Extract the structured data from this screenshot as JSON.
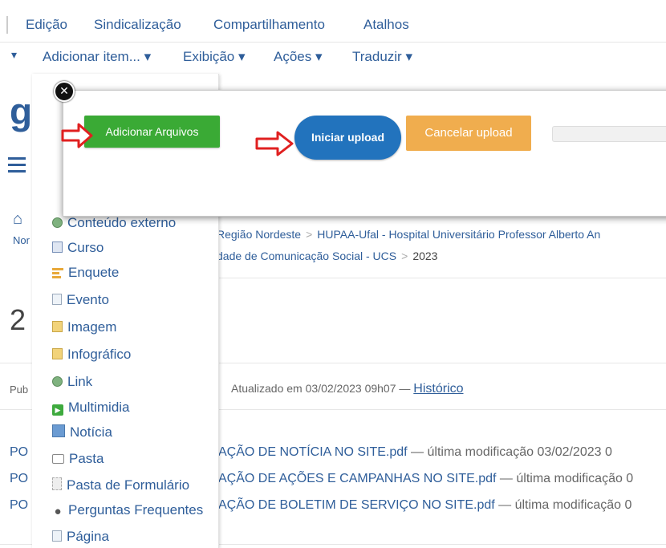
{
  "top_menu": {
    "items": [
      "Edição",
      "Sindicalização",
      "Compartilhamento",
      "Atalhos"
    ]
  },
  "toolbar": {
    "left_arrow": "▾",
    "items": [
      "Adicionar item... ▾",
      "Exibição ▾",
      "Ações ▾",
      "Traduzir ▾"
    ]
  },
  "background": {
    "logo_letter": "g",
    "home_icon": "⌂",
    "nav_prefix": "Nor",
    "breadcrumb_line1": [
      "Região Nordeste",
      "HUPAA-Ufal - Hospital Universitário Professor Alberto An"
    ],
    "breadcrumb_line2": [
      "dade de Comunicação Social - UCS",
      "2023"
    ],
    "breadcrumb_sep": ">",
    "big_title": "2",
    "published_prefix": "Pub",
    "updated_text": "Atualizado em 03/02/2023 09h07 —",
    "history_link": "Histórico",
    "files": [
      {
        "prefix": "PO",
        "name": "AÇÃO DE NOTÍCIA NO SITE.pdf",
        "mod": " — última modificação 03/02/2023 0"
      },
      {
        "prefix": "PO",
        "name": "AÇÃO DE AÇÕES E CAMPANHAS NO SITE.pdf",
        "mod": " — última modificação 0"
      },
      {
        "prefix": "PO",
        "name": "AÇÃO DE BOLETIM DE SERVIÇO NO SITE.pdf",
        "mod": " — última modificação 0"
      }
    ]
  },
  "dropdown": {
    "items": [
      {
        "label": "Conteúdo externo",
        "icon": "globe-icon"
      },
      {
        "label": "Curso",
        "icon": "course-icon"
      },
      {
        "label": "Enquete",
        "icon": "poll-icon"
      },
      {
        "label": "Evento",
        "icon": "event-icon"
      },
      {
        "label": "Imagem",
        "icon": "image-icon"
      },
      {
        "label": "Infográfico",
        "icon": "infographic-icon"
      },
      {
        "label": "Link",
        "icon": "link-icon"
      },
      {
        "label": "Multimidia",
        "icon": "multimedia-icon"
      },
      {
        "label": "Notícia",
        "icon": "news-icon"
      },
      {
        "label": "Pasta",
        "icon": "folder-icon"
      },
      {
        "label": "Pasta de Formulário",
        "icon": "form-folder-icon"
      },
      {
        "label": "Perguntas Frequentes",
        "icon": "faq-icon"
      },
      {
        "label": "Página",
        "icon": "page-icon"
      }
    ]
  },
  "upload_modal": {
    "close_label": "✕",
    "add_files": "Adicionar Arquivos",
    "start_upload": "Iniciar upload",
    "cancel_upload": "Cancelar upload",
    "progress": 0
  },
  "colors": {
    "link": "#2f5e9a",
    "add_button": "#3aaa35",
    "start_button": "#2273bd",
    "cancel_button": "#f0ad4e",
    "annotation_arrow": "#e02020"
  }
}
